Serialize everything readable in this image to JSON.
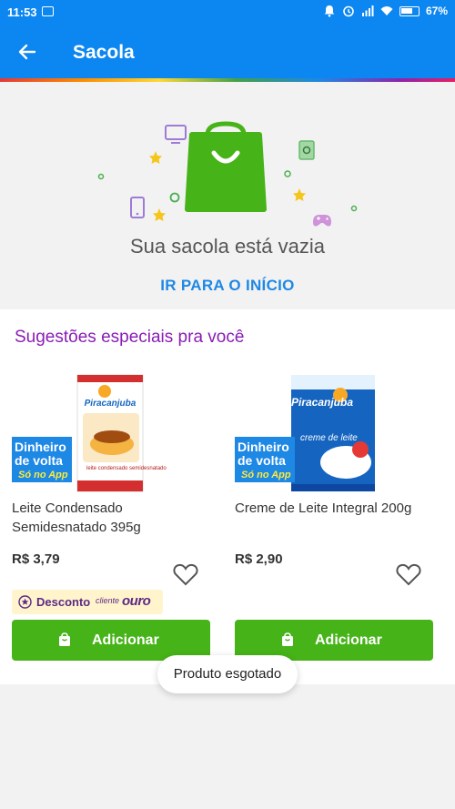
{
  "status_bar": {
    "time": "11:53",
    "battery": "67%",
    "icons": [
      "message-icon",
      "alarm-bell-icon",
      "alarm-clock-icon",
      "signal-icon",
      "wifi-icon",
      "battery-icon"
    ]
  },
  "app_bar": {
    "title": "Sacola",
    "back_icon": "arrow-left-icon",
    "color": "#0c86f0"
  },
  "empty_bag": {
    "message": "Sua sacola está vazia",
    "action_label": "IR PARA O INÍCIO",
    "illustration_icon": "shopping-bag-icon"
  },
  "suggestions": {
    "title": "Sugestões especiais pra você",
    "products": [
      {
        "name": "Leite Condensado Semidesnatado 395g",
        "price": "R$ 3,79",
        "promo_badge_line1": "Dinheiro",
        "promo_badge_line2": "de volta",
        "promo_badge_line3": "Só no App",
        "brand": "Piracanjuba",
        "package_text": "leite condensado semidesnatado",
        "discount_label": "Desconto",
        "discount_program_prefix": "cliente",
        "discount_program": "ouro",
        "add_label": "Adicionar"
      },
      {
        "name": "Creme de Leite Integral 200g",
        "price": "R$ 2,90",
        "promo_badge_line1": "Dinheiro",
        "promo_badge_line2": "de volta",
        "promo_badge_line3": "Só no App",
        "brand": "Piracanjuba",
        "package_text": "creme de leite",
        "add_label": "Adicionar"
      }
    ]
  },
  "toast": "Produto esgotado",
  "colors": {
    "primary": "#0c86f0",
    "accent_green": "#46b318",
    "suggest_title": "#8a1db5",
    "link": "#1e88e5"
  }
}
